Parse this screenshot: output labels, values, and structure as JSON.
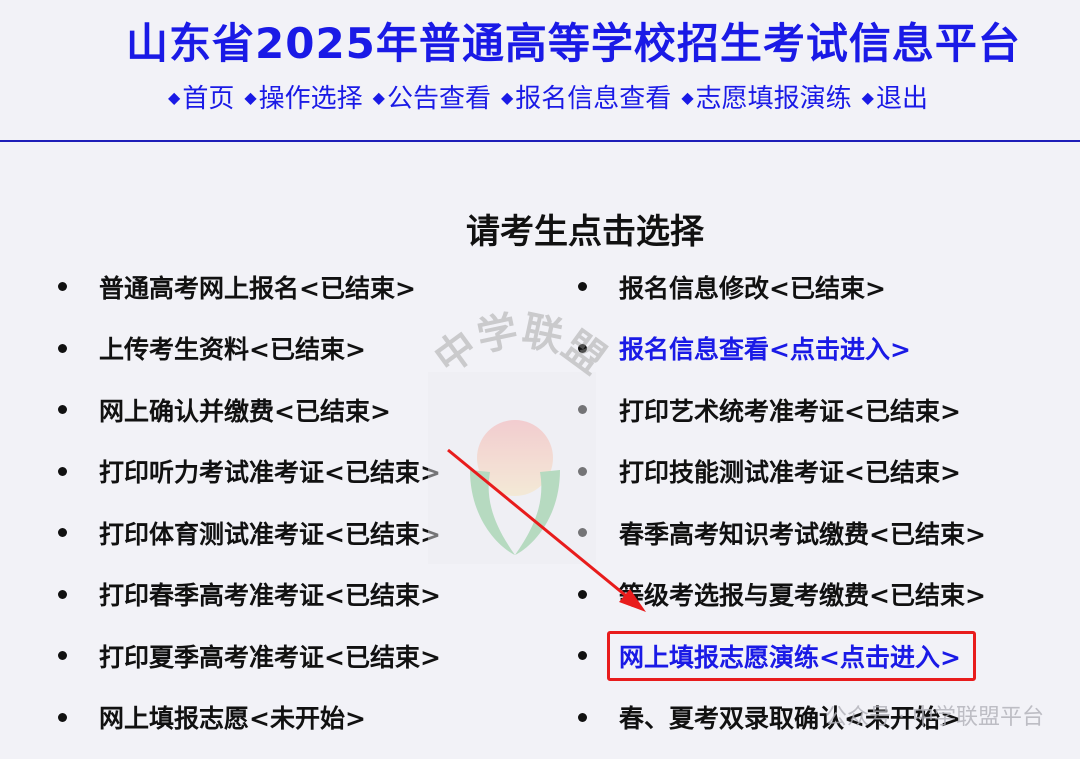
{
  "header": {
    "title": "山东省2025年普通高等学校招生考试信息平台",
    "nav": [
      {
        "label": "首页"
      },
      {
        "label": "操作选择"
      },
      {
        "label": "公告查看"
      },
      {
        "label": "报名信息查看"
      },
      {
        "label": "志愿填报演练"
      },
      {
        "label": "退出"
      }
    ]
  },
  "main": {
    "title": "请考生点击选择",
    "left_options": [
      {
        "label": "普通高考网上报名<已结束>"
      },
      {
        "label": "上传考生资料<已结束>"
      },
      {
        "label": "网上确认并缴费<已结束>"
      },
      {
        "label": "打印听力考试准考证<已结束>"
      },
      {
        "label": "打印体育测试准考证<已结束>"
      },
      {
        "label": "打印春季高考准考证<已结束>"
      },
      {
        "label": "打印夏季高考准考证<已结束>"
      },
      {
        "label": "网上填报志愿<未开始>"
      }
    ],
    "right_options": [
      {
        "label": "报名信息修改<已结束>"
      },
      {
        "label": "报名信息查看<点击进入>"
      },
      {
        "label": "打印艺术统考准考证<已结束>"
      },
      {
        "label": "打印技能测试准考证<已结束>"
      },
      {
        "label": "春季高考知识考试缴费<已结束>"
      },
      {
        "label": "等级考选报与夏考缴费<已结束>"
      },
      {
        "label": "网上填报志愿演练<点击进入>"
      },
      {
        "label": "春、夏考双录取确认<未开始>"
      }
    ]
  },
  "watermark": {
    "text": "中学联盟",
    "footer_text": "公众号 · 中学联盟平台"
  },
  "colors": {
    "link": "#1a1ae6",
    "highlight_box": "#e81c1c",
    "arrow": "#e81c1c"
  }
}
